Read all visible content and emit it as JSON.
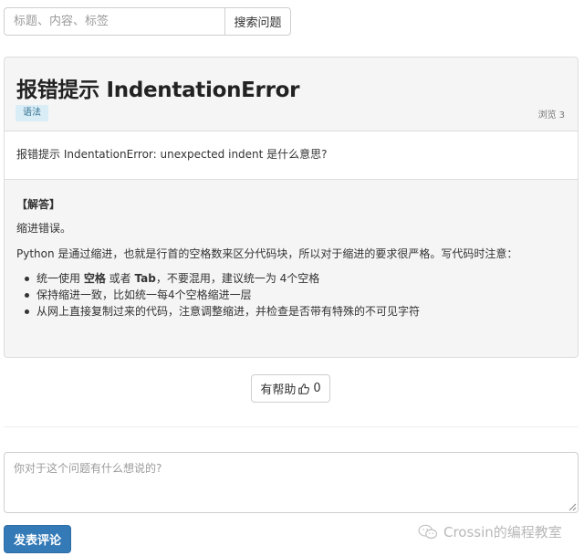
{
  "search": {
    "placeholder": "标题、内容、标签",
    "button_label": "搜索问题"
  },
  "question": {
    "title": "报错提示 IndentationError",
    "tag": "语法",
    "views_label": "浏览",
    "views_count": "3",
    "body": "报错提示 IndentationError: unexpected indent 是什么意思?"
  },
  "answer": {
    "heading": "【解答】",
    "summary": "缩进错误。",
    "intro": "Python 是通过缩进，也就是行首的空格数来区分代码块，所以对于缩进的要求很严格。写代码时注意：",
    "items": [
      {
        "pre": "统一使用 ",
        "b1": "空格",
        "mid": " 或者 ",
        "b2": "Tab",
        "post": "，不要混用，建议统一为 4个空格"
      },
      {
        "text": "保持缩进一致，比如统一每4个空格缩进一层"
      },
      {
        "text": "从网上直接复制过来的代码，注意调整缩进，并检查是否带有特殊的不可见字符"
      }
    ]
  },
  "helpful": {
    "label": "有帮助",
    "count": "0",
    "icon": "thumbs-up-icon"
  },
  "comment": {
    "placeholder": "你对于这个问题有什么想说的?",
    "submit_label": "发表评论"
  },
  "watermark": {
    "text": "Crossin的编程教室",
    "icon": "wechat-icon"
  },
  "colors": {
    "primary": "#337ab7",
    "tag_bg": "#d9edf7",
    "tag_text": "#31708f",
    "panel_bg": "#f5f5f5"
  }
}
